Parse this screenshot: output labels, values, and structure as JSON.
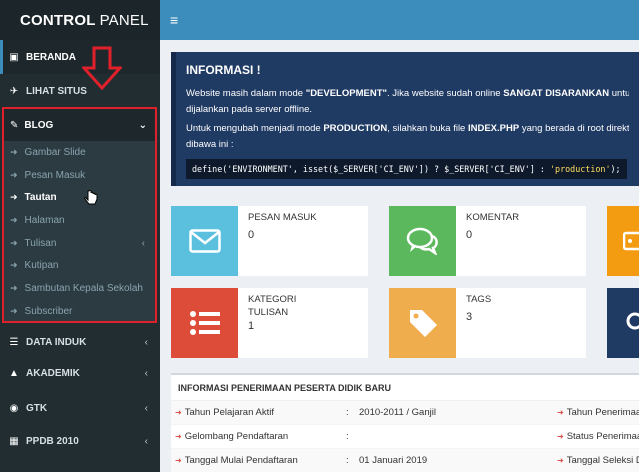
{
  "brand": {
    "bold": "CONTROL",
    "thin": "PANEL"
  },
  "sidebar": {
    "beranda": "BERANDA",
    "lihat_situs": "LIHAT SITUS",
    "blog": "BLOG",
    "blog_items": [
      "Gambar Slide",
      "Pesan Masuk",
      "Tautan",
      "Halaman",
      "Tulisan",
      "Kutipan",
      "Sambutan Kepala Sekolah",
      "Subscriber"
    ],
    "data_induk": "DATA INDUK",
    "akademik": "AKADEMIK",
    "gtk": "GTK",
    "ppdb": "PPDB 2010"
  },
  "topbar": {
    "menu_icon": "≡"
  },
  "info": {
    "title": "INFORMASI !",
    "line1_a": "Website masih dalam mode ",
    "line1_b": "\"DEVELOPMENT\"",
    "line1_c": ". Jika website sudah online ",
    "line1_d": "SANGAT DISARANKAN",
    "line1_e": " untuk mengubah",
    "line2": "dijalankan pada server offline.",
    "line3_a": "Untuk mengubah menjadi mode ",
    "line3_b": "PRODUCTION",
    "line3_c": ", silahkan buka file ",
    "line3_d": "INDEX.PHP",
    "line3_e": " yang berada di root direktori CMS S",
    "line4": "dibawa ini :",
    "code_a": "define('ENVIRONMENT', isset($_SERVER['CI_ENV']) ? $_SERVER['CI_ENV'] : ",
    "code_b": "'production'",
    "code_c": ");"
  },
  "cards": {
    "pesan_label": "PESAN MASUK",
    "pesan_value": "0",
    "komentar_label": "KOMENTAR",
    "komentar_value": "0",
    "kategori_label1": "KATEGORI",
    "kategori_label2": "TULISAN",
    "kategori_value": "1",
    "tags_label": "TAGS",
    "tags_value": "3"
  },
  "colors": {
    "blue": "#3c8dbc",
    "aqua": "#5bc0de",
    "green": "#5cb85c",
    "red": "#dd4b39",
    "yellow": "#f0ad4e",
    "navy": "#1f3a63"
  },
  "table": {
    "title": "INFORMASI PENERIMAAN PESERTA DIDIK BARU",
    "rows": [
      {
        "label": "Tahun Pelajaran Aktif",
        "sep": ":",
        "value": "2010-2011 / Ganjil",
        "right": "Tahun Penerimaan"
      },
      {
        "label": "Gelombang Pendaftaran",
        "sep": ":",
        "value": "",
        "right": "Status Penerimaan"
      },
      {
        "label": "Tanggal Mulai Pendaftaran",
        "sep": ":",
        "value": "01 Januari 2019",
        "right": "Tanggal Seleksi D"
      }
    ]
  }
}
